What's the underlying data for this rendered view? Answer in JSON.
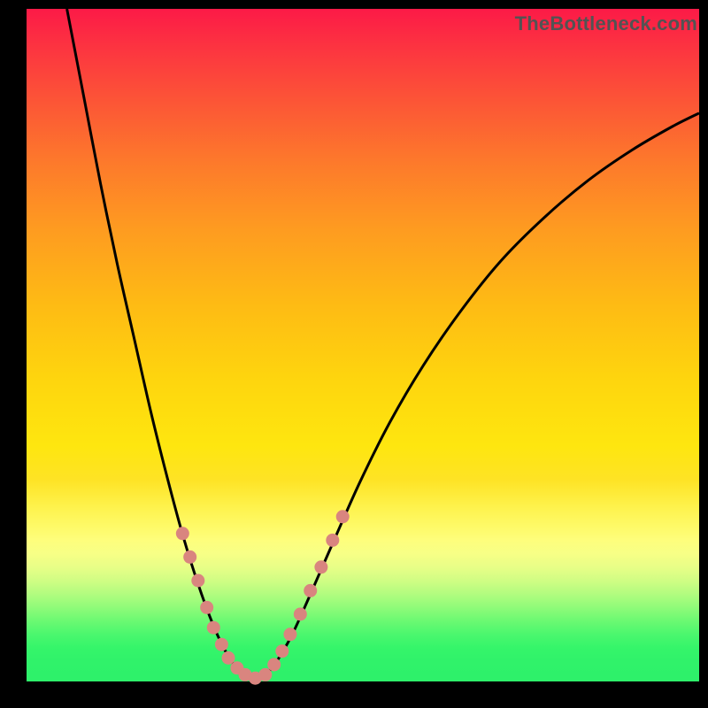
{
  "watermark": "TheBottleneck.com",
  "chart_data": {
    "type": "line",
    "title": "",
    "xlabel": "",
    "ylabel": "",
    "series": [
      {
        "name": "curve",
        "points": [
          {
            "x": 0.06,
            "y": 1.0
          },
          {
            "x": 0.085,
            "y": 0.87
          },
          {
            "x": 0.11,
            "y": 0.74
          },
          {
            "x": 0.135,
            "y": 0.62
          },
          {
            "x": 0.16,
            "y": 0.51
          },
          {
            "x": 0.185,
            "y": 0.4
          },
          {
            "x": 0.21,
            "y": 0.3
          },
          {
            "x": 0.233,
            "y": 0.215
          },
          {
            "x": 0.255,
            "y": 0.145
          },
          {
            "x": 0.275,
            "y": 0.09
          },
          {
            "x": 0.293,
            "y": 0.05
          },
          {
            "x": 0.31,
            "y": 0.023
          },
          {
            "x": 0.327,
            "y": 0.01
          },
          {
            "x": 0.34,
            "y": 0.005
          },
          {
            "x": 0.355,
            "y": 0.01
          },
          {
            "x": 0.372,
            "y": 0.03
          },
          {
            "x": 0.395,
            "y": 0.07
          },
          {
            "x": 0.42,
            "y": 0.125
          },
          {
            "x": 0.455,
            "y": 0.205
          },
          {
            "x": 0.495,
            "y": 0.295
          },
          {
            "x": 0.54,
            "y": 0.385
          },
          {
            "x": 0.59,
            "y": 0.47
          },
          {
            "x": 0.645,
            "y": 0.55
          },
          {
            "x": 0.705,
            "y": 0.625
          },
          {
            "x": 0.77,
            "y": 0.69
          },
          {
            "x": 0.835,
            "y": 0.745
          },
          {
            "x": 0.9,
            "y": 0.79
          },
          {
            "x": 0.96,
            "y": 0.825
          },
          {
            "x": 1.0,
            "y": 0.845
          }
        ]
      }
    ],
    "dots": [
      {
        "x": 0.232,
        "y": 0.22
      },
      {
        "x": 0.243,
        "y": 0.185
      },
      {
        "x": 0.255,
        "y": 0.15
      },
      {
        "x": 0.268,
        "y": 0.11
      },
      {
        "x": 0.278,
        "y": 0.08
      },
      {
        "x": 0.29,
        "y": 0.055
      },
      {
        "x": 0.3,
        "y": 0.035
      },
      {
        "x": 0.313,
        "y": 0.02
      },
      {
        "x": 0.325,
        "y": 0.01
      },
      {
        "x": 0.34,
        "y": 0.005
      },
      {
        "x": 0.355,
        "y": 0.01
      },
      {
        "x": 0.368,
        "y": 0.025
      },
      {
        "x": 0.38,
        "y": 0.045
      },
      {
        "x": 0.392,
        "y": 0.07
      },
      {
        "x": 0.407,
        "y": 0.1
      },
      {
        "x": 0.422,
        "y": 0.135
      },
      {
        "x": 0.438,
        "y": 0.17
      },
      {
        "x": 0.455,
        "y": 0.21
      },
      {
        "x": 0.47,
        "y": 0.245
      }
    ],
    "gradient_colors": {
      "top": "#fc1a47",
      "mid": "#fed50e",
      "bottom": "#2ef16a"
    },
    "dot_color": "#d9857f",
    "xlim": [
      0,
      1
    ],
    "ylim": [
      0,
      1
    ]
  }
}
